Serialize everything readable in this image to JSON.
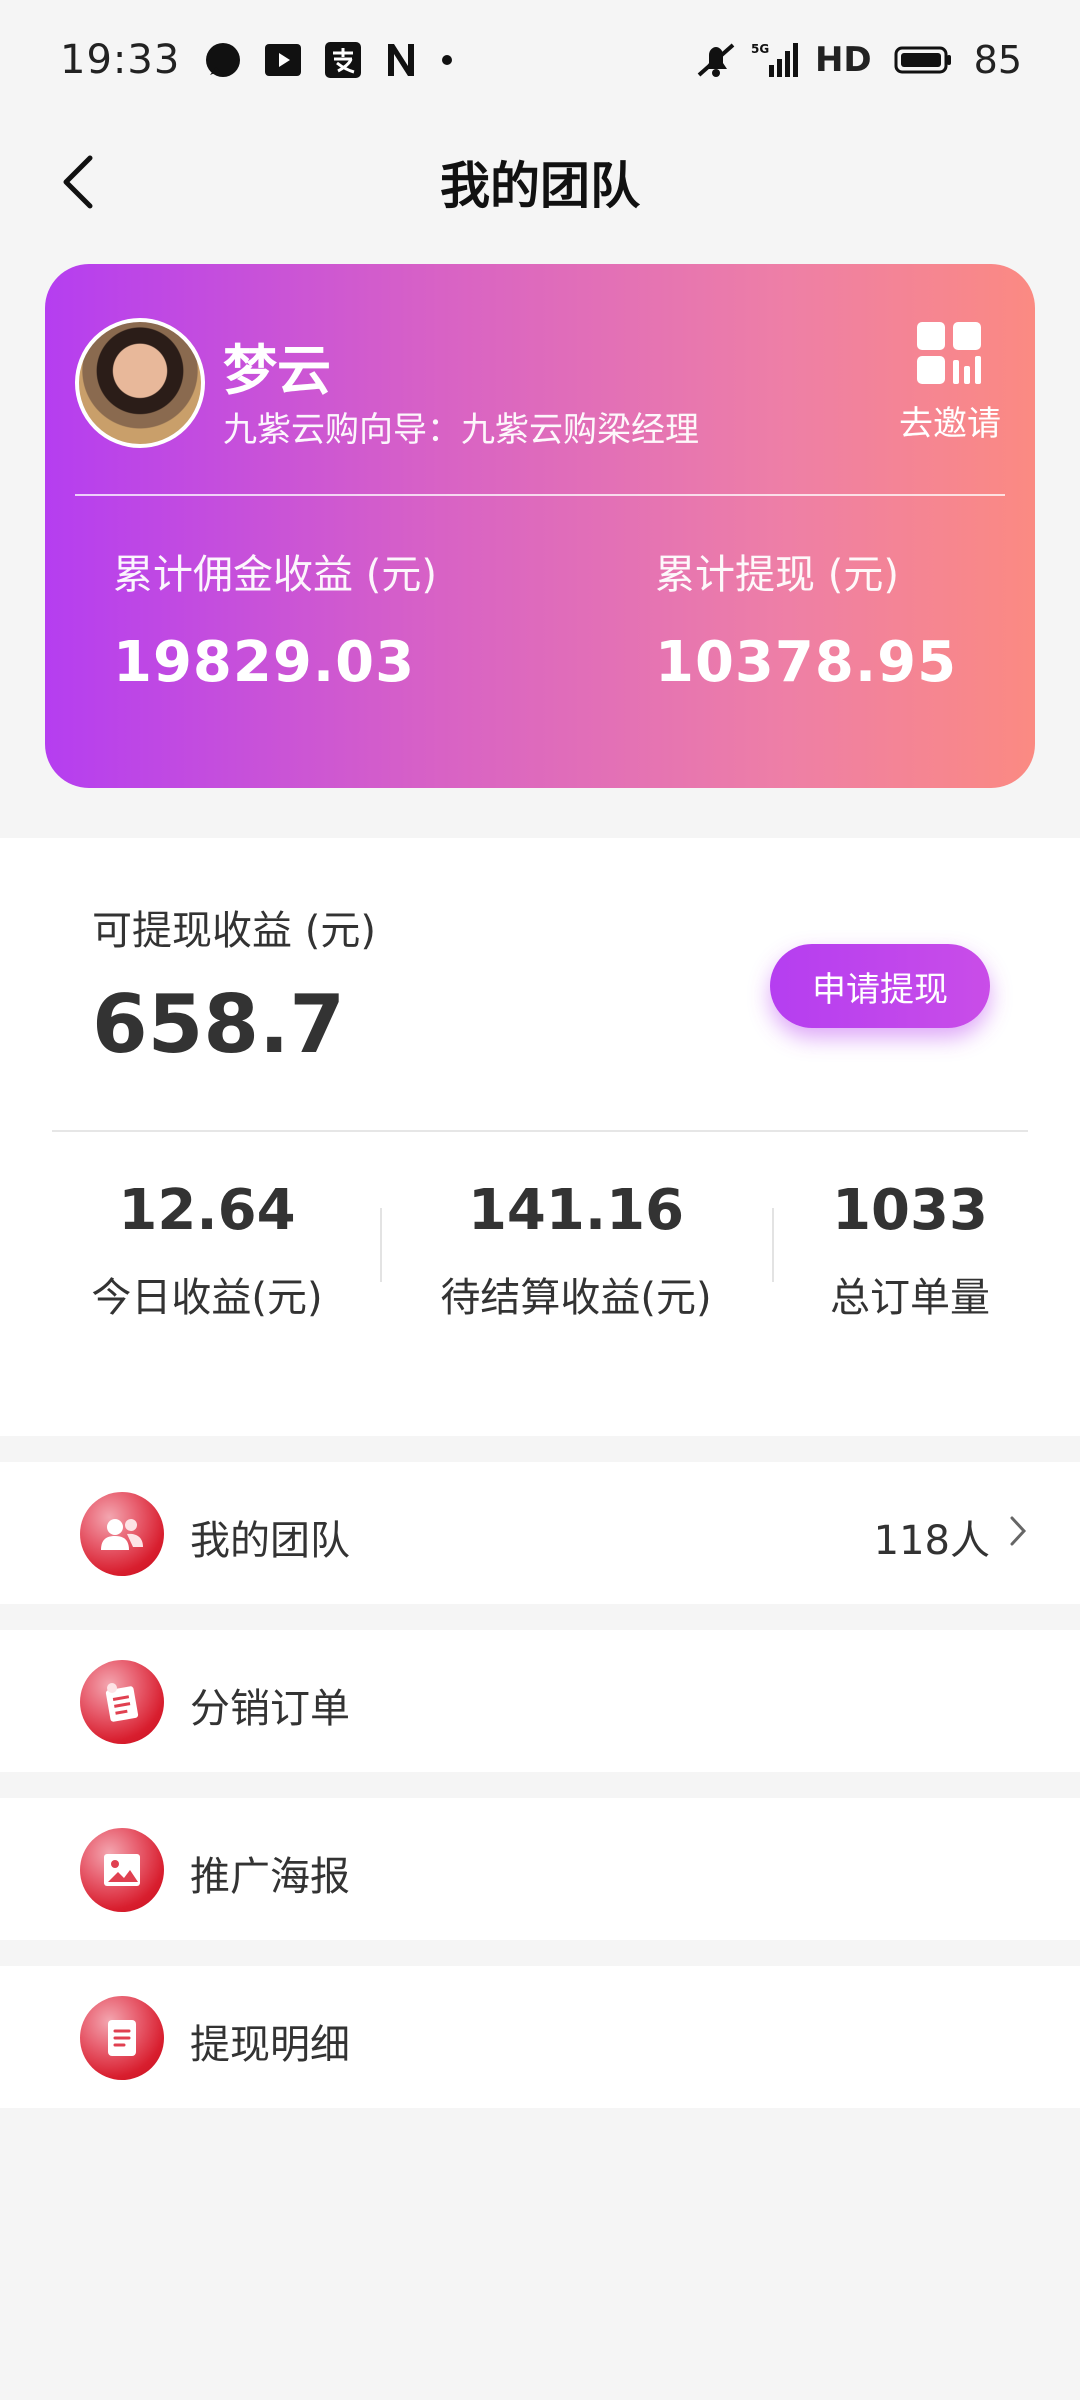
{
  "status_bar": {
    "time": "19:33",
    "left_icons": [
      "chat-bubble-icon",
      "youtube-icon",
      "alipay-icon",
      "n-app-icon",
      "dot-icon"
    ],
    "right_icons": [
      "mute-icon",
      "5g-signal-icon",
      "battery-icon"
    ],
    "hd": "HD",
    "battery": "85"
  },
  "header": {
    "title": "我的团队"
  },
  "profile": {
    "name": "梦云",
    "role": "九紫云购向导：九紫云购梁经理",
    "invite_label": "去邀请",
    "total_commission_label": "累计佣金收益 (元)",
    "total_commission": "19829.03",
    "total_withdrawn_label": "累计提现 (元)",
    "total_withdrawn": "10378.95"
  },
  "earnings": {
    "available_label": "可提现收益 (元)",
    "available": "658.7",
    "withdraw_button": "申请提现",
    "stats": [
      {
        "value": "12.64",
        "label": "今日收益(元)"
      },
      {
        "value": "141.16",
        "label": "待结算收益(元)"
      },
      {
        "value": "1033",
        "label": "总订单量"
      }
    ]
  },
  "menu": [
    {
      "label": "我的团队",
      "count": "118人",
      "icon": "team-icon"
    },
    {
      "label": "分销订单",
      "count": "",
      "icon": "order-icon"
    },
    {
      "label": "推广海报",
      "count": "",
      "icon": "poster-icon"
    },
    {
      "label": "提现明细",
      "count": "",
      "icon": "withdraw-detail-icon"
    }
  ],
  "colors": {
    "gradient_start": "#b53ef0",
    "gradient_end": "#fb8a82",
    "accent_purple": "#b53ef0",
    "menu_icon_red": "#d81e2e"
  }
}
